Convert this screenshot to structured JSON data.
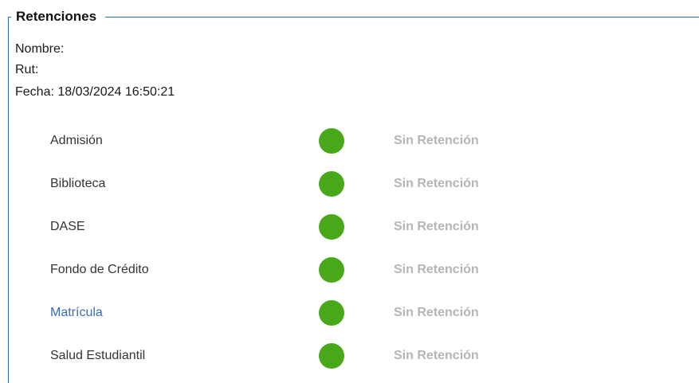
{
  "section": {
    "legend": "Retenciones"
  },
  "info": {
    "nombre": "Nombre:",
    "rut": "Rut:",
    "fecha": "Fecha: 18/03/2024 16:50:21"
  },
  "status_color": "#48a81a",
  "rows": [
    {
      "label": "Admisión",
      "status": "Sin Retención",
      "link": false
    },
    {
      "label": "Biblioteca",
      "status": "Sin Retención",
      "link": false
    },
    {
      "label": "DASE",
      "status": "Sin Retención",
      "link": false
    },
    {
      "label": "Fondo de Crédito",
      "status": "Sin Retención",
      "link": false
    },
    {
      "label": "Matrícula",
      "status": "Sin Retención",
      "link": true
    },
    {
      "label": "Salud Estudiantil",
      "status": "Sin Retención",
      "link": false
    }
  ]
}
